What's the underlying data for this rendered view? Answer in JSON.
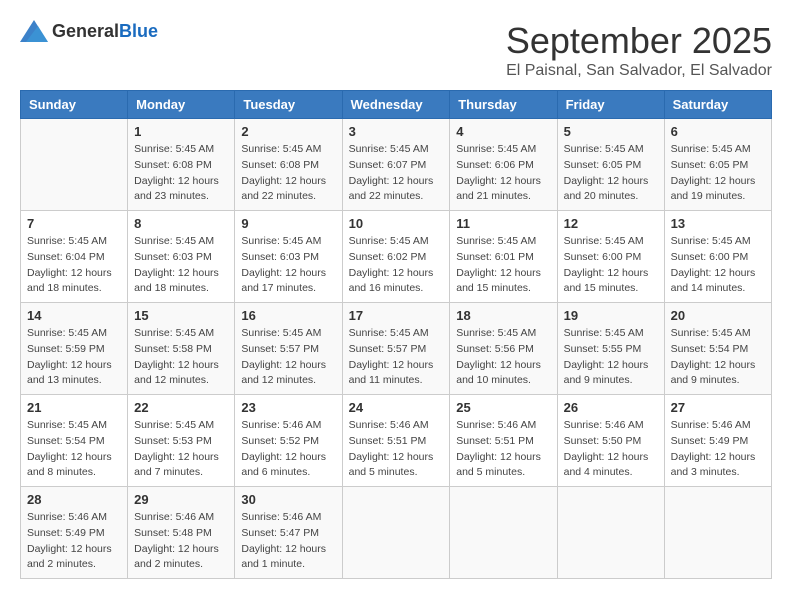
{
  "header": {
    "logo_general": "General",
    "logo_blue": "Blue",
    "month_title": "September 2025",
    "subtitle": "El Paisnal, San Salvador, El Salvador"
  },
  "weekdays": [
    "Sunday",
    "Monday",
    "Tuesday",
    "Wednesday",
    "Thursday",
    "Friday",
    "Saturday"
  ],
  "weeks": [
    [
      {
        "day": "",
        "info": ""
      },
      {
        "day": "1",
        "info": "Sunrise: 5:45 AM\nSunset: 6:08 PM\nDaylight: 12 hours\nand 23 minutes."
      },
      {
        "day": "2",
        "info": "Sunrise: 5:45 AM\nSunset: 6:08 PM\nDaylight: 12 hours\nand 22 minutes."
      },
      {
        "day": "3",
        "info": "Sunrise: 5:45 AM\nSunset: 6:07 PM\nDaylight: 12 hours\nand 22 minutes."
      },
      {
        "day": "4",
        "info": "Sunrise: 5:45 AM\nSunset: 6:06 PM\nDaylight: 12 hours\nand 21 minutes."
      },
      {
        "day": "5",
        "info": "Sunrise: 5:45 AM\nSunset: 6:05 PM\nDaylight: 12 hours\nand 20 minutes."
      },
      {
        "day": "6",
        "info": "Sunrise: 5:45 AM\nSunset: 6:05 PM\nDaylight: 12 hours\nand 19 minutes."
      }
    ],
    [
      {
        "day": "7",
        "info": "Sunrise: 5:45 AM\nSunset: 6:04 PM\nDaylight: 12 hours\nand 18 minutes."
      },
      {
        "day": "8",
        "info": "Sunrise: 5:45 AM\nSunset: 6:03 PM\nDaylight: 12 hours\nand 18 minutes."
      },
      {
        "day": "9",
        "info": "Sunrise: 5:45 AM\nSunset: 6:03 PM\nDaylight: 12 hours\nand 17 minutes."
      },
      {
        "day": "10",
        "info": "Sunrise: 5:45 AM\nSunset: 6:02 PM\nDaylight: 12 hours\nand 16 minutes."
      },
      {
        "day": "11",
        "info": "Sunrise: 5:45 AM\nSunset: 6:01 PM\nDaylight: 12 hours\nand 15 minutes."
      },
      {
        "day": "12",
        "info": "Sunrise: 5:45 AM\nSunset: 6:00 PM\nDaylight: 12 hours\nand 15 minutes."
      },
      {
        "day": "13",
        "info": "Sunrise: 5:45 AM\nSunset: 6:00 PM\nDaylight: 12 hours\nand 14 minutes."
      }
    ],
    [
      {
        "day": "14",
        "info": "Sunrise: 5:45 AM\nSunset: 5:59 PM\nDaylight: 12 hours\nand 13 minutes."
      },
      {
        "day": "15",
        "info": "Sunrise: 5:45 AM\nSunset: 5:58 PM\nDaylight: 12 hours\nand 12 minutes."
      },
      {
        "day": "16",
        "info": "Sunrise: 5:45 AM\nSunset: 5:57 PM\nDaylight: 12 hours\nand 12 minutes."
      },
      {
        "day": "17",
        "info": "Sunrise: 5:45 AM\nSunset: 5:57 PM\nDaylight: 12 hours\nand 11 minutes."
      },
      {
        "day": "18",
        "info": "Sunrise: 5:45 AM\nSunset: 5:56 PM\nDaylight: 12 hours\nand 10 minutes."
      },
      {
        "day": "19",
        "info": "Sunrise: 5:45 AM\nSunset: 5:55 PM\nDaylight: 12 hours\nand 9 minutes."
      },
      {
        "day": "20",
        "info": "Sunrise: 5:45 AM\nSunset: 5:54 PM\nDaylight: 12 hours\nand 9 minutes."
      }
    ],
    [
      {
        "day": "21",
        "info": "Sunrise: 5:45 AM\nSunset: 5:54 PM\nDaylight: 12 hours\nand 8 minutes."
      },
      {
        "day": "22",
        "info": "Sunrise: 5:45 AM\nSunset: 5:53 PM\nDaylight: 12 hours\nand 7 minutes."
      },
      {
        "day": "23",
        "info": "Sunrise: 5:46 AM\nSunset: 5:52 PM\nDaylight: 12 hours\nand 6 minutes."
      },
      {
        "day": "24",
        "info": "Sunrise: 5:46 AM\nSunset: 5:51 PM\nDaylight: 12 hours\nand 5 minutes."
      },
      {
        "day": "25",
        "info": "Sunrise: 5:46 AM\nSunset: 5:51 PM\nDaylight: 12 hours\nand 5 minutes."
      },
      {
        "day": "26",
        "info": "Sunrise: 5:46 AM\nSunset: 5:50 PM\nDaylight: 12 hours\nand 4 minutes."
      },
      {
        "day": "27",
        "info": "Sunrise: 5:46 AM\nSunset: 5:49 PM\nDaylight: 12 hours\nand 3 minutes."
      }
    ],
    [
      {
        "day": "28",
        "info": "Sunrise: 5:46 AM\nSunset: 5:49 PM\nDaylight: 12 hours\nand 2 minutes."
      },
      {
        "day": "29",
        "info": "Sunrise: 5:46 AM\nSunset: 5:48 PM\nDaylight: 12 hours\nand 2 minutes."
      },
      {
        "day": "30",
        "info": "Sunrise: 5:46 AM\nSunset: 5:47 PM\nDaylight: 12 hours\nand 1 minute."
      },
      {
        "day": "",
        "info": ""
      },
      {
        "day": "",
        "info": ""
      },
      {
        "day": "",
        "info": ""
      },
      {
        "day": "",
        "info": ""
      }
    ]
  ]
}
